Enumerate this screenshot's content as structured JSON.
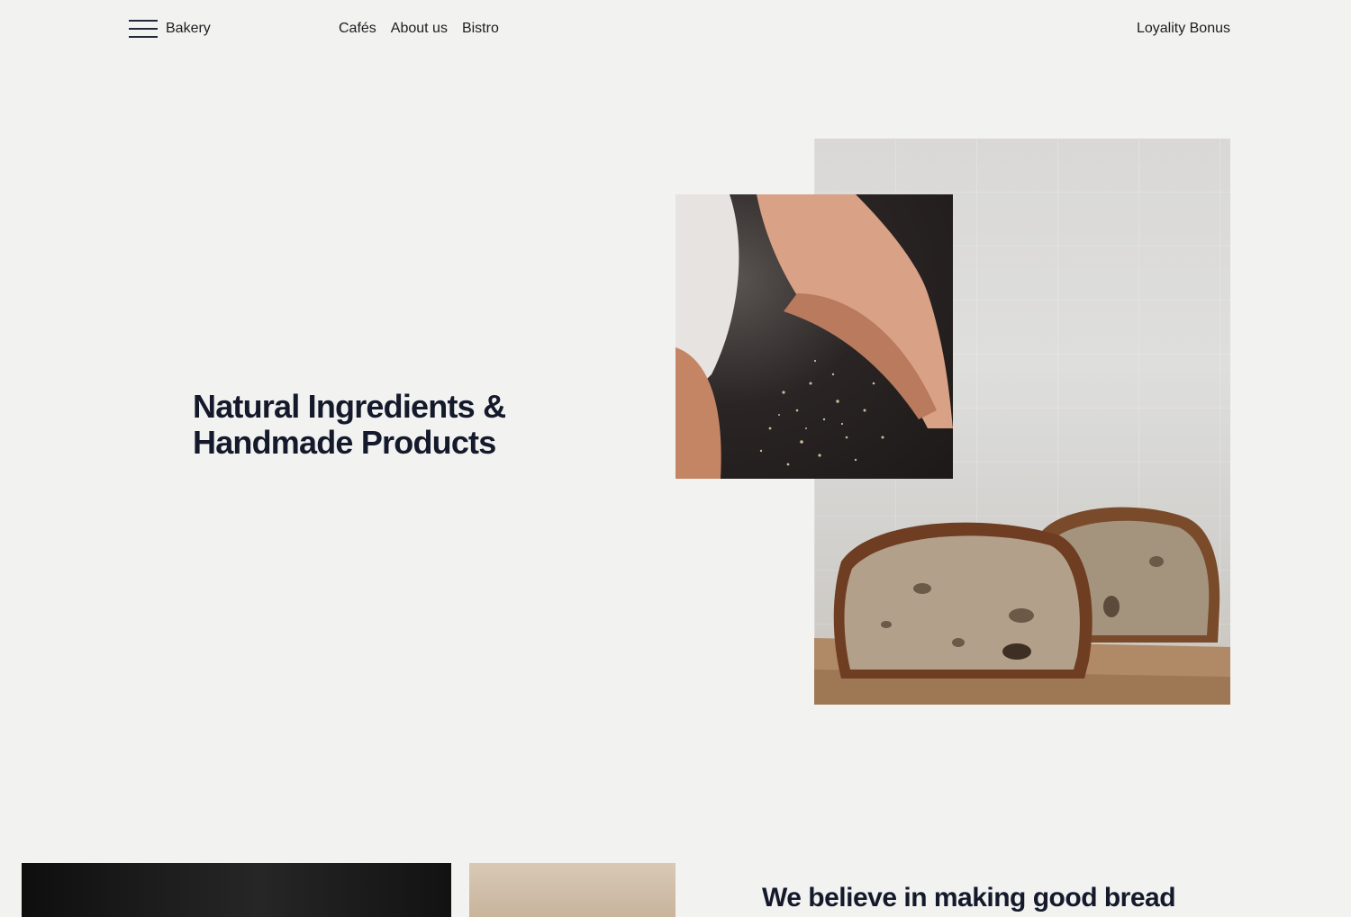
{
  "header": {
    "brand": "Bakery",
    "nav": [
      "Cafés",
      "About us",
      "Bistro"
    ],
    "loyalty": "Loyality Bonus"
  },
  "hero": {
    "title_line1": "Natural Ingredients &",
    "title_line2": "Handmade Products"
  },
  "section2": {
    "heading": "We believe in making good bread"
  },
  "colors": {
    "background": "#f2f2f1",
    "text_dark": "#141a2b"
  },
  "icons": [
    "hamburger-menu-icon"
  ]
}
